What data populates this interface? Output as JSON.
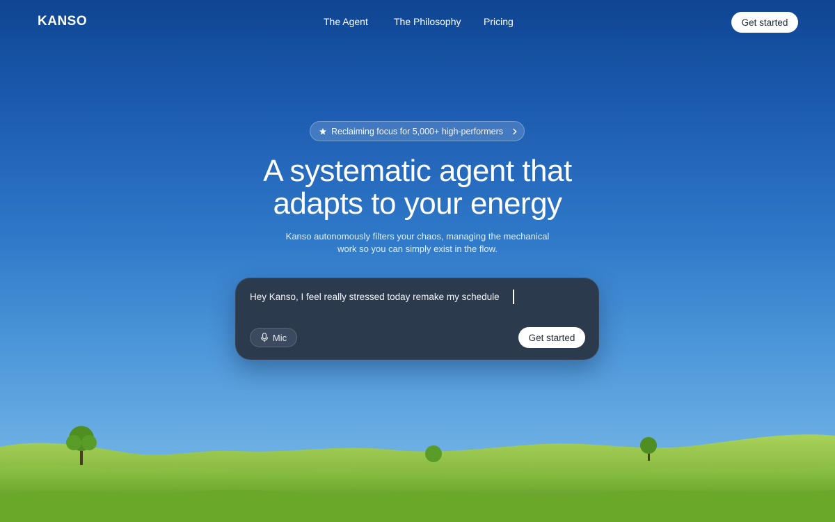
{
  "brand": {
    "name": "KANSO"
  },
  "nav": {
    "links": [
      {
        "label": "The Agent"
      },
      {
        "label": "The Philosophy"
      },
      {
        "label": "Pricing"
      }
    ],
    "cta_label": "Get started"
  },
  "hero": {
    "badge": {
      "icon": "star-icon",
      "text": "Reclaiming focus for 5,000+ high-performers",
      "trailing_icon": "chevron-right-icon"
    },
    "headline_lines": [
      "A systematic agent that",
      "adapts to your energy"
    ],
    "subhead_lines": [
      "Kanso autonomously filters your chaos, managing the mechanical",
      "work so you can simply exist in the flow."
    ]
  },
  "prompt": {
    "value": "Hey Kanso, I feel really stressed today remake my schedule",
    "mic_label": "Mic",
    "mic_icon": "microphone-icon",
    "submit_label": "Get started"
  },
  "colors": {
    "sky_top": "#0f4592",
    "sky_bottom": "#7dbbe6",
    "prompt_bg": "#2c3a4e",
    "grass": "#7fb93a"
  }
}
